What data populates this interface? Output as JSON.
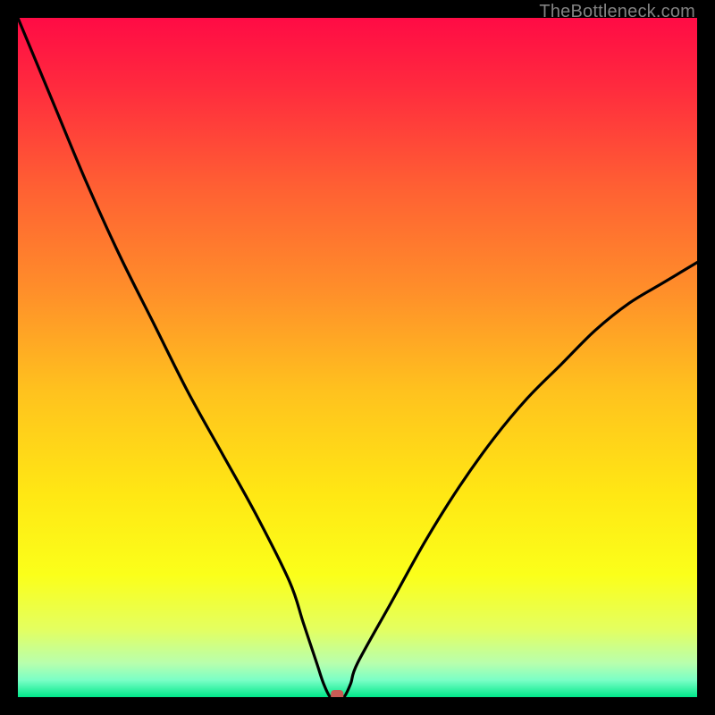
{
  "watermark": "TheBottleneck.com",
  "chart_data": {
    "type": "line",
    "title": "",
    "xlabel": "",
    "ylabel": "",
    "xlim": [
      0,
      100
    ],
    "ylim": [
      0,
      100
    ],
    "x": [
      0,
      5,
      10,
      15,
      20,
      25,
      30,
      35,
      40,
      42,
      44,
      45,
      46,
      47,
      48,
      49,
      50,
      55,
      60,
      65,
      70,
      75,
      80,
      85,
      90,
      95,
      100
    ],
    "values": [
      100,
      88,
      76,
      65,
      55,
      45,
      36,
      27,
      17,
      11,
      5,
      2,
      0,
      0,
      0,
      2,
      5,
      14,
      23,
      31,
      38,
      44,
      49,
      54,
      58,
      61,
      64
    ],
    "marker": {
      "x": 47,
      "y": 0
    },
    "gradient_stops": [
      {
        "offset": 0,
        "color": "#ff0b45"
      },
      {
        "offset": 0.1,
        "color": "#ff2a3e"
      },
      {
        "offset": 0.25,
        "color": "#ff6033"
      },
      {
        "offset": 0.4,
        "color": "#ff8e2a"
      },
      {
        "offset": 0.55,
        "color": "#ffc21e"
      },
      {
        "offset": 0.7,
        "color": "#ffe714"
      },
      {
        "offset": 0.82,
        "color": "#fbff1a"
      },
      {
        "offset": 0.9,
        "color": "#e4ff60"
      },
      {
        "offset": 0.95,
        "color": "#b8ffad"
      },
      {
        "offset": 0.975,
        "color": "#7affc6"
      },
      {
        "offset": 1.0,
        "color": "#00e88a"
      }
    ],
    "curve_color": "#000000",
    "marker_color": "#c95b55"
  }
}
